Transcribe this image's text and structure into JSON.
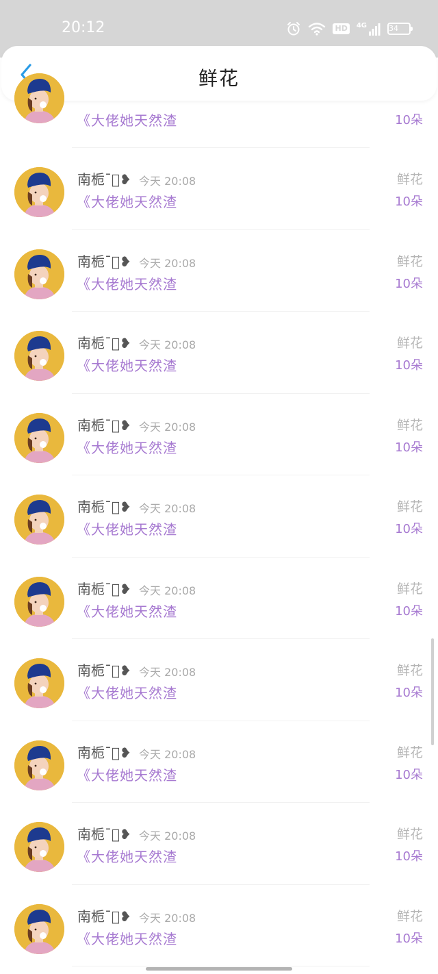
{
  "status": {
    "time": "20:12",
    "battery": "34",
    "network": "4G",
    "hd": "HD"
  },
  "header": {
    "title": "鲜花"
  },
  "first_item": {
    "book": "《大佬她天然渣",
    "count": "10朵"
  },
  "items": [
    {
      "name": "南栀ˉ͛‍❥",
      "time": "今天 20:08",
      "book": "《大佬她天然渣",
      "type": "鲜花",
      "count": "10朵"
    },
    {
      "name": "南栀ˉ͛‍❥",
      "time": "今天 20:08",
      "book": "《大佬她天然渣",
      "type": "鲜花",
      "count": "10朵"
    },
    {
      "name": "南栀ˉ͛‍❥",
      "time": "今天 20:08",
      "book": "《大佬她天然渣",
      "type": "鲜花",
      "count": "10朵"
    },
    {
      "name": "南栀ˉ͛‍❥",
      "time": "今天 20:08",
      "book": "《大佬她天然渣",
      "type": "鲜花",
      "count": "10朵"
    },
    {
      "name": "南栀ˉ͛‍❥",
      "time": "今天 20:08",
      "book": "《大佬她天然渣",
      "type": "鲜花",
      "count": "10朵"
    },
    {
      "name": "南栀ˉ͛‍❥",
      "time": "今天 20:08",
      "book": "《大佬她天然渣",
      "type": "鲜花",
      "count": "10朵"
    },
    {
      "name": "南栀ˉ͛‍❥",
      "time": "今天 20:08",
      "book": "《大佬她天然渣",
      "type": "鲜花",
      "count": "10朵"
    },
    {
      "name": "南栀ˉ͛‍❥",
      "time": "今天 20:08",
      "book": "《大佬她天然渣",
      "type": "鲜花",
      "count": "10朵"
    },
    {
      "name": "南栀ˉ͛‍❥",
      "time": "今天 20:08",
      "book": "《大佬她天然渣",
      "type": "鲜花",
      "count": "10朵"
    },
    {
      "name": "南栀ˉ͛‍❥",
      "time": "今天 20:08",
      "book": "《大佬她天然渣",
      "type": "鲜花",
      "count": "10朵"
    }
  ],
  "colors": {
    "accent": "#a77ad1",
    "back_icon": "#2a9be6",
    "status_bar": "#d6d6d6"
  }
}
